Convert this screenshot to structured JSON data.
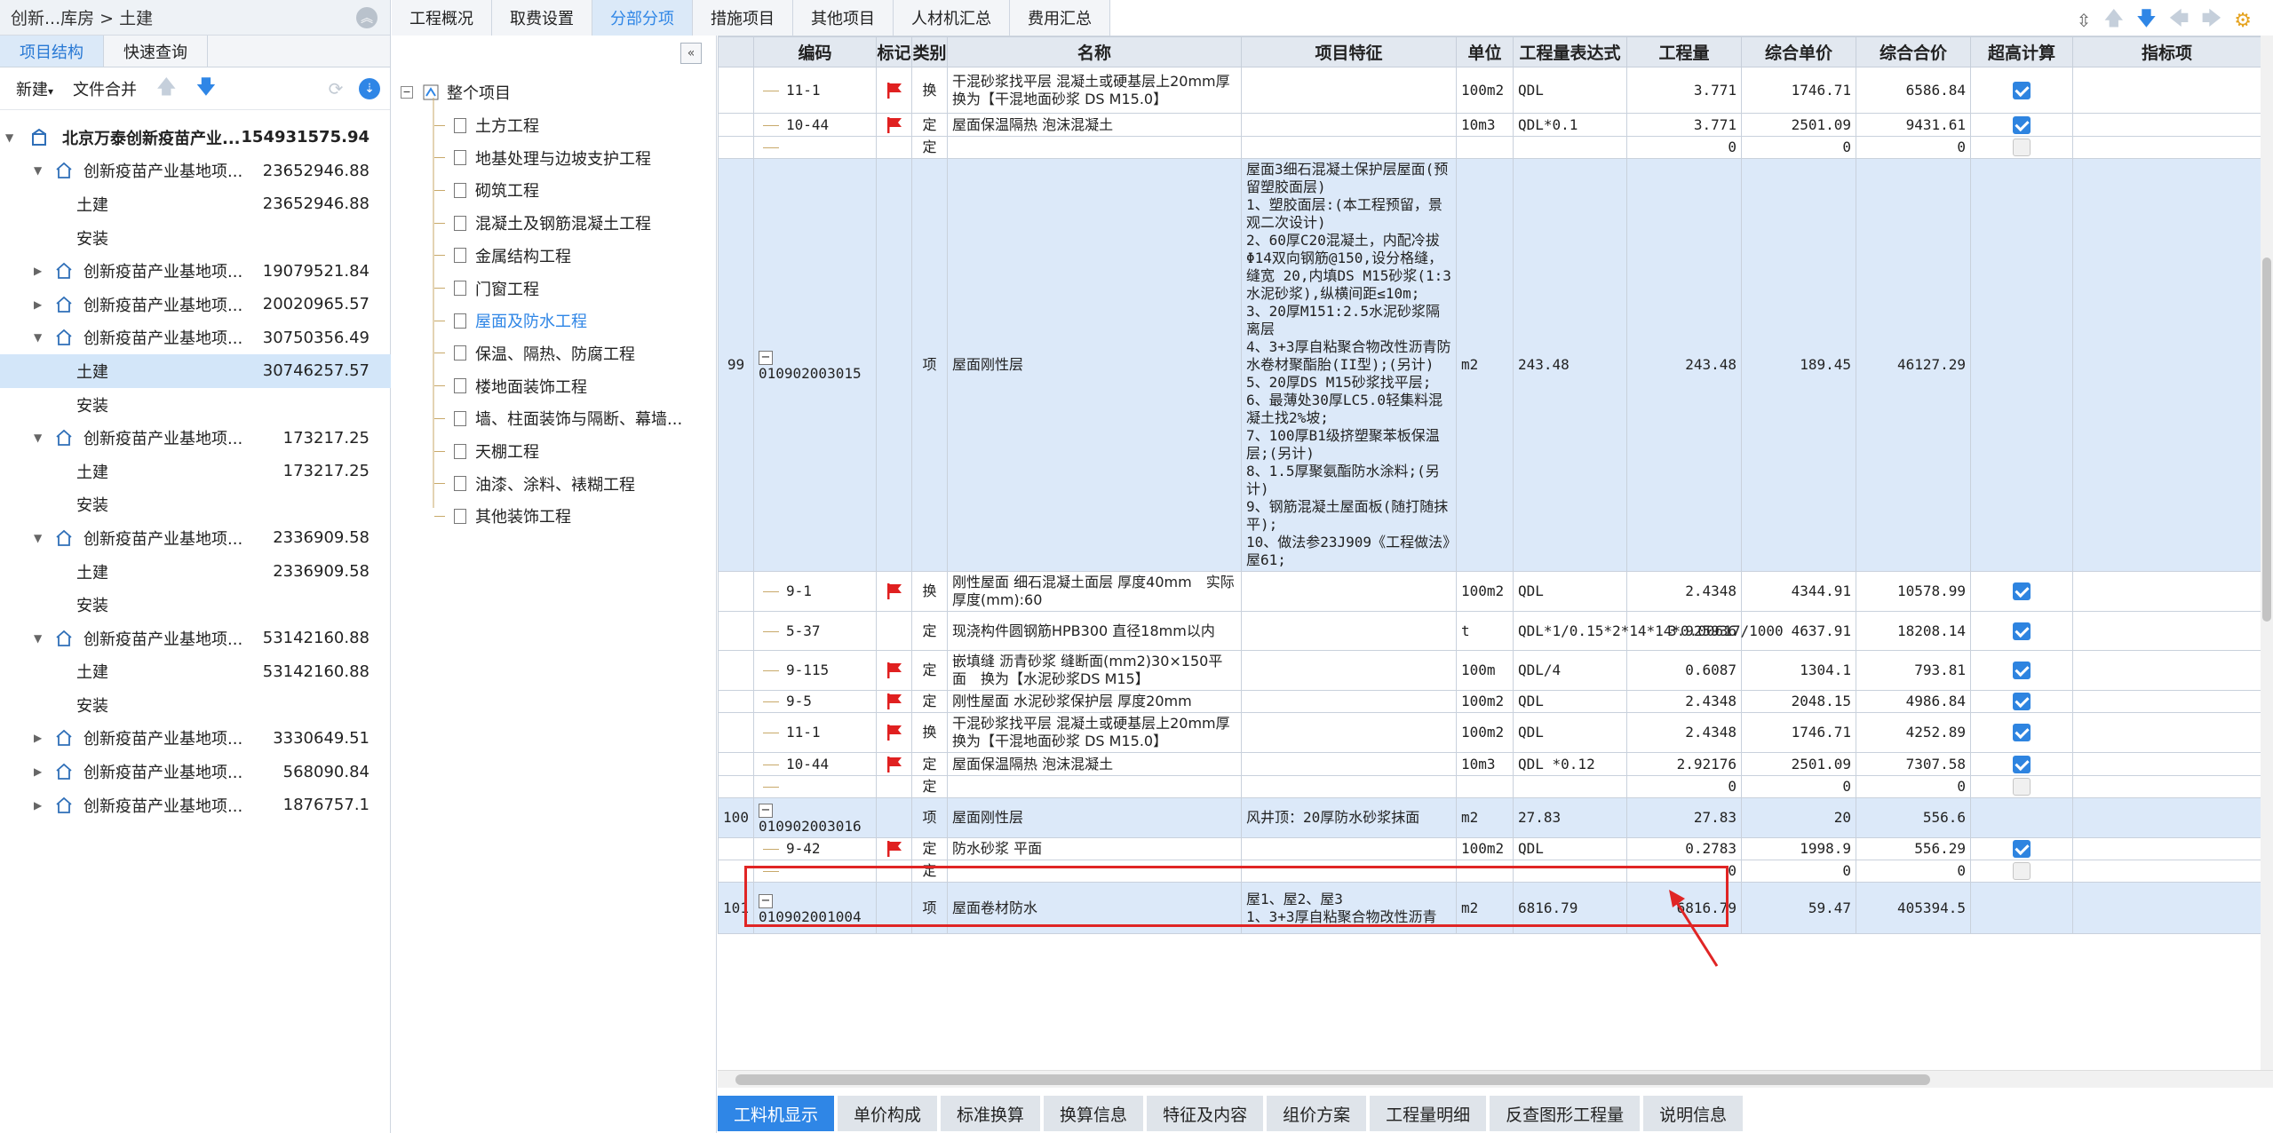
{
  "breadcrumb": "创新...库房 > 土建",
  "left_tabs": [
    "项目结构",
    "快速查询"
  ],
  "left_toolbar": {
    "new": "新建",
    "merge": "文件合并"
  },
  "tree": [
    {
      "label": "北京万泰创新疫苗产业...",
      "value": "154931575.94",
      "level": 0,
      "toggle": "▼",
      "root": true
    },
    {
      "label": "创新疫苗产业基地项...",
      "value": "23652946.88",
      "level": 1,
      "toggle": "▼"
    },
    {
      "label": "土建",
      "value": "23652946.88",
      "level": 2
    },
    {
      "label": "安装",
      "value": "",
      "level": 2
    },
    {
      "label": "创新疫苗产业基地项...",
      "value": "19079521.84",
      "level": 1,
      "toggle": "▶"
    },
    {
      "label": "创新疫苗产业基地项...",
      "value": "20020965.57",
      "level": 1,
      "toggle": "▶"
    },
    {
      "label": "创新疫苗产业基地项...",
      "value": "30750356.49",
      "level": 1,
      "toggle": "▼"
    },
    {
      "label": "土建",
      "value": "30746257.57",
      "level": 2,
      "selected": true
    },
    {
      "label": "安装",
      "value": "",
      "level": 2
    },
    {
      "label": "创新疫苗产业基地项...",
      "value": "173217.25",
      "level": 1,
      "toggle": "▼"
    },
    {
      "label": "土建",
      "value": "173217.25",
      "level": 2
    },
    {
      "label": "安装",
      "value": "",
      "level": 2
    },
    {
      "label": "创新疫苗产业基地项...",
      "value": "2336909.58",
      "level": 1,
      "toggle": "▼"
    },
    {
      "label": "土建",
      "value": "2336909.58",
      "level": 2
    },
    {
      "label": "安装",
      "value": "",
      "level": 2
    },
    {
      "label": "创新疫苗产业基地项...",
      "value": "53142160.88",
      "level": 1,
      "toggle": "▼"
    },
    {
      "label": "土建",
      "value": "53142160.88",
      "level": 2
    },
    {
      "label": "安装",
      "value": "",
      "level": 2
    },
    {
      "label": "创新疫苗产业基地项...",
      "value": "3330649.51",
      "level": 1,
      "toggle": "▶"
    },
    {
      "label": "创新疫苗产业基地项...",
      "value": "568090.84",
      "level": 1,
      "toggle": "▶"
    },
    {
      "label": "创新疫苗产业基地项...",
      "value": "1876757.1",
      "level": 1,
      "toggle": "▶"
    }
  ],
  "mid_tree": {
    "root": "整个项目",
    "items": [
      "土方工程",
      "地基处理与边坡支护工程",
      "砌筑工程",
      "混凝土及钢筋混凝土工程",
      "金属结构工程",
      "门窗工程",
      "屋面及防水工程",
      "保温、隔热、防腐工程",
      "楼地面装饰工程",
      "墙、柱面装饰与隔断、幕墙...",
      "天棚工程",
      "油漆、涂料、裱糊工程",
      "其他装饰工程"
    ],
    "selected_index": 6
  },
  "top_tabs": [
    "工程概况",
    "取费设置",
    "分部分项",
    "措施项目",
    "其他项目",
    "人材机汇总",
    "费用汇总"
  ],
  "top_tab_active": 2,
  "columns": [
    "编码",
    "标记",
    "类别",
    "名称",
    "项目特征",
    "单位",
    "工程量表达式",
    "工程量",
    "综合单价",
    "综合合价",
    "超高计算",
    "指标项"
  ],
  "rows": [
    {
      "h": 52,
      "code": "11-1",
      "flag": true,
      "type": "换",
      "name": "干混砂浆找平层 混凝土或硬基层上20mm厚　换为【干混地面砂浆 DS M15.0】",
      "unit": "100m2",
      "expr": "QDL",
      "qty": "3.771",
      "price": "1746.71",
      "total": "6586.84",
      "cb": "on"
    },
    {
      "h": 26,
      "code": "10-44",
      "flag": true,
      "type": "定",
      "name": "屋面保温隔热 泡沫混凝土",
      "unit": "10m3",
      "expr": "QDL*0.1",
      "qty": "3.771",
      "price": "2501.09",
      "total": "9431.61",
      "cb": "on"
    },
    {
      "h": 22,
      "code": "",
      "type": "定",
      "qty": "0",
      "price": "0",
      "total": "0",
      "cb": "off"
    },
    {
      "h": 328,
      "q": true,
      "no": "99",
      "code": "010902003015",
      "type": "项",
      "name": "屋面刚性层",
      "feature": [
        "屋面3细石混凝土保护层屋面(预留塑胶面层)",
        "1、塑胶面层:(本工程预留，景观二次设计)",
        "2、60厚C20混凝土，内配冷拔Φ14双向钢筋@150,设分格缝，缝宽 20,内填DS M15砂浆(1:3水泥砂浆),纵横间距≤10m;",
        "3、20厚M151:2.5水泥砂浆隔离层",
        "4、3+3厚自粘聚合物改性沥青防水卷材聚酯胎(II型);(另计)",
        "5、20厚DS M15砂浆找平层;",
        "6、最薄处30厚LC5.0轻集料混凝土找2%坡;",
        "7、100厚B1级挤塑聚苯板保温层;(另计)",
        "8、1.5厚聚氨酯防水涂料;(另计)",
        "9、钢筋混凝土屋面板(随打随抹平);",
        "10、做法参23J909《工程做法》屋61;"
      ],
      "unit": "m2",
      "expr": "243.48",
      "qty": "243.48",
      "price": "189.45",
      "total": "46127.29"
    },
    {
      "h": 30,
      "code": "9-1",
      "flag": true,
      "type": "换",
      "name": "刚性屋面 细石混凝土面层 厚度40mm　实际厚度(mm):60",
      "unit": "100m2",
      "expr": "QDL",
      "qty": "2.4348",
      "price": "4344.91",
      "total": "10578.99",
      "cb": "on"
    },
    {
      "h": 44,
      "code": "5-37",
      "type": "定",
      "name": "现浇构件圆钢筋HPB300 直径18mm以内",
      "unit": "t",
      "expr": "QDL*1/0.15*2*14*14*0.00617/1000",
      "qty": "3.925936",
      "price": "4637.91",
      "total": "18208.14",
      "cb": "on"
    },
    {
      "h": 30,
      "code": "9-115",
      "flag": true,
      "type": "定",
      "name": "嵌填缝 沥青砂浆 缝断面(mm2)30×150平面　换为【水泥砂浆DS M15】",
      "unit": "100m",
      "expr": "QDL/4",
      "qty": "0.6087",
      "price": "1304.1",
      "total": "793.81",
      "cb": "on"
    },
    {
      "h": 22,
      "code": "9-5",
      "flag": true,
      "type": "定",
      "name": "刚性屋面 水泥砂浆保护层 厚度20mm",
      "unit": "100m2",
      "expr": "QDL",
      "qty": "2.4348",
      "price": "2048.15",
      "total": "4986.84",
      "cb": "on"
    },
    {
      "h": 30,
      "code": "11-1",
      "flag": true,
      "type": "换",
      "name": "干混砂浆找平层 混凝土或硬基层上20mm厚　换为【干混地面砂浆 DS M15.0】",
      "unit": "100m2",
      "expr": "QDL",
      "qty": "2.4348",
      "price": "1746.71",
      "total": "4252.89",
      "cb": "on"
    },
    {
      "h": 26,
      "code": "10-44",
      "flag": true,
      "type": "定",
      "name": "屋面保温隔热 泡沫混凝土",
      "unit": "10m3",
      "expr": "QDL *0.12",
      "qty": "2.92176",
      "price": "2501.09",
      "total": "7307.58",
      "cb": "on"
    },
    {
      "h": 22,
      "code": "",
      "type": "定",
      "qty": "0",
      "price": "0",
      "total": "0",
      "cb": "off"
    },
    {
      "h": 22,
      "q": true,
      "no": "100",
      "code": "010902003016",
      "type": "项",
      "name": "屋面刚性层",
      "feature": [
        "风井顶：20厚防水砂浆抹面"
      ],
      "unit": "m2",
      "expr": "27.83",
      "qty": "27.83",
      "price": "20",
      "total": "556.6"
    },
    {
      "h": 22,
      "code": "9-42",
      "flag": true,
      "type": "定",
      "name": "防水砂浆 平面",
      "unit": "100m2",
      "expr": "QDL",
      "qty": "0.2783",
      "price": "1998.9",
      "total": "556.29",
      "cb": "on"
    },
    {
      "h": 22,
      "code": "",
      "type": "定",
      "qty": "0",
      "price": "0",
      "total": "0",
      "cb": "off"
    },
    {
      "h": 58,
      "q": true,
      "no": "101",
      "code": "010902001004",
      "type": "项",
      "name": "屋面卷材防水",
      "feature": [
        "屋1、屋2、屋3",
        "1、3+3厚自粘聚合物改性沥青"
      ],
      "unit": "m2",
      "expr": "6816.79",
      "qty": "6816.79",
      "price": "59.47",
      "total": "405394.5"
    }
  ],
  "bottom_tabs": [
    "工料机显示",
    "单价构成",
    "标准换算",
    "换算信息",
    "特征及内容",
    "组价方案",
    "工程量明细",
    "反查图形工程量",
    "说明信息"
  ],
  "bottom_tab_active": 0
}
